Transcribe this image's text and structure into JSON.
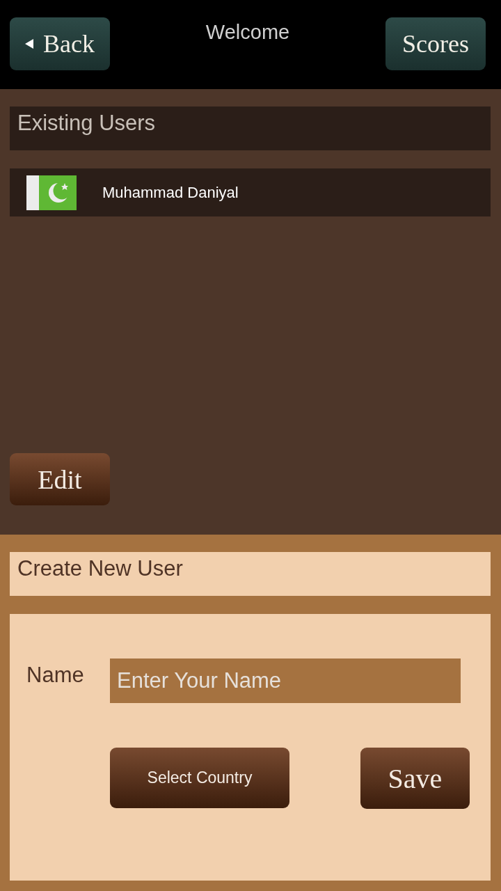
{
  "header": {
    "back_button": "Back",
    "title": "Welcome",
    "scores_button": "Scores"
  },
  "existing_users": {
    "title": "Existing Users",
    "users": [
      {
        "name": "Muhammad Daniyal"
      }
    ],
    "edit_button": "Edit"
  },
  "create_user": {
    "title": "Create New User",
    "name_label": "Name",
    "name_field": {
      "placeholder": "Enter Your Name"
    },
    "select_country_button": "Select Country",
    "save_button": "Save"
  }
}
